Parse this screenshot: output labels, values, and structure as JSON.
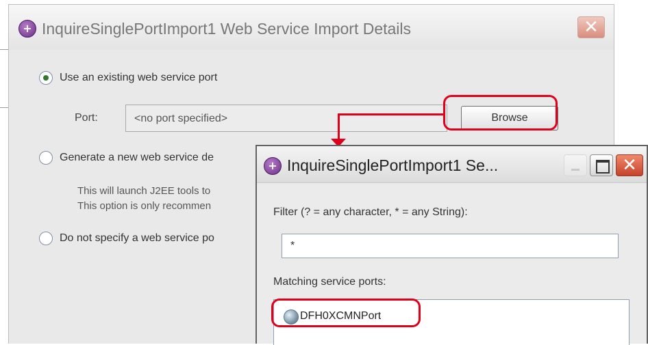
{
  "main_dialog": {
    "title": "InquireSinglePortImport1 Web Service Import Details",
    "close_glyph": "✕",
    "option_existing": "Use an existing web service port",
    "port_label": "Port:",
    "port_value": "<no port specified>",
    "browse_label": "Browse",
    "option_generate": "Generate a new web service de",
    "generate_help_line1": "This will launch J2EE tools to",
    "generate_help_line2": "This option is only recommen",
    "option_none": "Do not specify a web service po",
    "selected_option": "option_existing"
  },
  "popup_dialog": {
    "title": "InquireSinglePortImport1 Se...",
    "close_glyph": "✕",
    "filter_label": "Filter (? = any character, * = any String):",
    "filter_value": "*",
    "matching_label": "Matching service ports:",
    "ports": [
      {
        "label": "DFH0XCMNPort",
        "icon": "globe-icon"
      }
    ]
  },
  "annotations": {
    "highlight_color": "#e0001a"
  }
}
